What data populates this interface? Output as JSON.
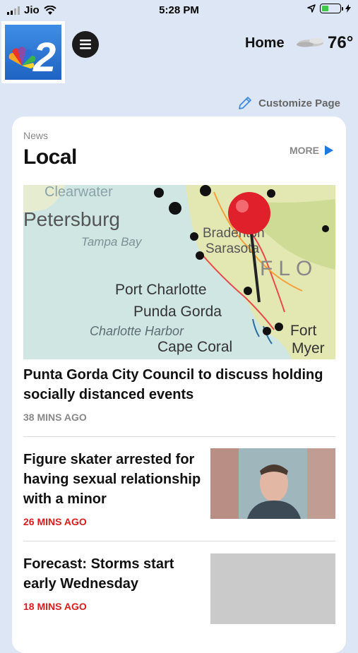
{
  "status": {
    "carrier": "Jio",
    "time": "5:28 PM"
  },
  "header": {
    "location_label": "Home",
    "temperature": "76°",
    "weather_icon": "partly-cloudy-icon",
    "logo_text": "2",
    "accent": "#1e63c3"
  },
  "toolbar": {
    "customize_label": "Customize Page"
  },
  "section": {
    "kicker": "News",
    "title": "Local",
    "more_label": "MORE"
  },
  "map": {
    "labels": [
      "Clearwater",
      "Petersburg",
      "Tampa Bay",
      "Bradenton",
      "Sarasota",
      "FLO",
      "Port Charlotte",
      "Punda Gorda",
      "Charlotte Harbor",
      "Cape Coral",
      "Fort",
      "Myer"
    ]
  },
  "stories": [
    {
      "headline": "Punta Gorda City Council to discuss holding socially distanced events",
      "time": "38 MINS AGO"
    },
    {
      "headline": "Figure skater arrested for having sexual relationship with a minor",
      "time": "26 MINS AGO"
    },
    {
      "headline": "Forecast: Storms start early Wednesday",
      "time": "18 MINS AGO"
    }
  ],
  "colors": {
    "background": "#dde6f4",
    "time_red": "#d81d1d",
    "card": "#ffffff"
  }
}
